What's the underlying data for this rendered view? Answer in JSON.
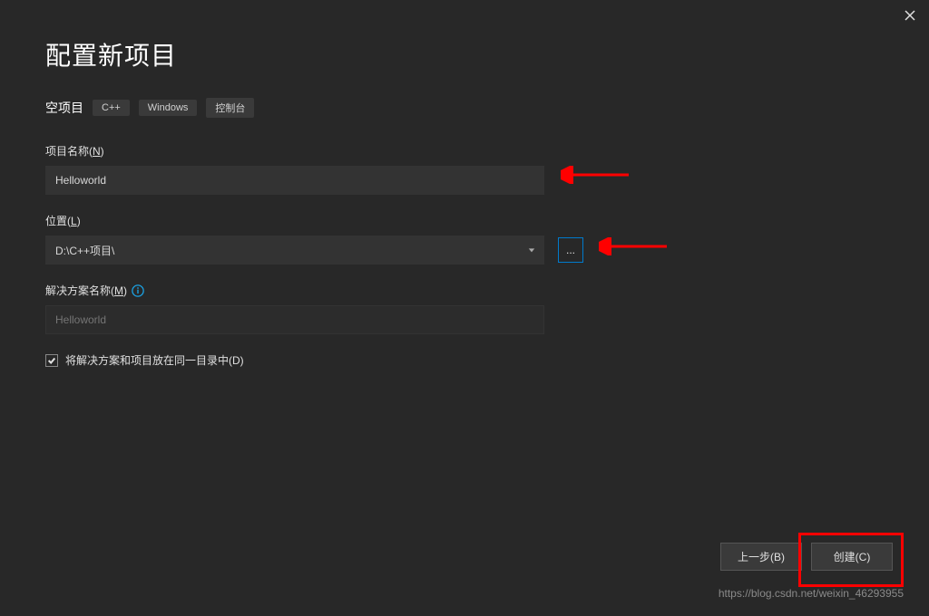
{
  "window": {
    "title": "配置新项目",
    "template_type": "空项目",
    "tags": [
      "C++",
      "Windows",
      "控制台"
    ]
  },
  "fields": {
    "project_name": {
      "label_pre": "项目名称(",
      "label_key": "N",
      "label_post": ")",
      "value": "Helloworld"
    },
    "location": {
      "label_pre": "位置(",
      "label_key": "L",
      "label_post": ")",
      "value": "D:\\C++项目\\",
      "browse_label": "..."
    },
    "solution_name": {
      "label_pre": "解决方案名称(",
      "label_key": "M",
      "label_post": ")",
      "placeholder": "Helloworld"
    },
    "same_dir": {
      "label_pre": "将解决方案和项目放在同一目录中(",
      "label_key": "D",
      "label_post": ")"
    }
  },
  "buttons": {
    "back_pre": "上一步(",
    "back_key": "B",
    "back_post": ")",
    "create_pre": "创建(",
    "create_key": "C",
    "create_post": ")"
  },
  "watermark": "https://blog.csdn.net/weixin_46293955"
}
